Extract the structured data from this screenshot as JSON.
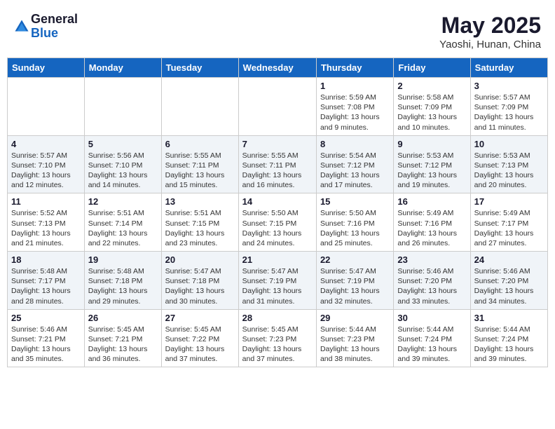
{
  "header": {
    "logo_general": "General",
    "logo_blue": "Blue",
    "month": "May 2025",
    "location": "Yaoshi, Hunan, China"
  },
  "weekdays": [
    "Sunday",
    "Monday",
    "Tuesday",
    "Wednesday",
    "Thursday",
    "Friday",
    "Saturday"
  ],
  "weeks": [
    [
      {
        "day": "",
        "sunrise": "",
        "sunset": "",
        "daylight": ""
      },
      {
        "day": "",
        "sunrise": "",
        "sunset": "",
        "daylight": ""
      },
      {
        "day": "",
        "sunrise": "",
        "sunset": "",
        "daylight": ""
      },
      {
        "day": "",
        "sunrise": "",
        "sunset": "",
        "daylight": ""
      },
      {
        "day": "1",
        "sunrise": "Sunrise: 5:59 AM",
        "sunset": "Sunset: 7:08 PM",
        "daylight": "Daylight: 13 hours and 9 minutes."
      },
      {
        "day": "2",
        "sunrise": "Sunrise: 5:58 AM",
        "sunset": "Sunset: 7:09 PM",
        "daylight": "Daylight: 13 hours and 10 minutes."
      },
      {
        "day": "3",
        "sunrise": "Sunrise: 5:57 AM",
        "sunset": "Sunset: 7:09 PM",
        "daylight": "Daylight: 13 hours and 11 minutes."
      }
    ],
    [
      {
        "day": "4",
        "sunrise": "Sunrise: 5:57 AM",
        "sunset": "Sunset: 7:10 PM",
        "daylight": "Daylight: 13 hours and 12 minutes."
      },
      {
        "day": "5",
        "sunrise": "Sunrise: 5:56 AM",
        "sunset": "Sunset: 7:10 PM",
        "daylight": "Daylight: 13 hours and 14 minutes."
      },
      {
        "day": "6",
        "sunrise": "Sunrise: 5:55 AM",
        "sunset": "Sunset: 7:11 PM",
        "daylight": "Daylight: 13 hours and 15 minutes."
      },
      {
        "day": "7",
        "sunrise": "Sunrise: 5:55 AM",
        "sunset": "Sunset: 7:11 PM",
        "daylight": "Daylight: 13 hours and 16 minutes."
      },
      {
        "day": "8",
        "sunrise": "Sunrise: 5:54 AM",
        "sunset": "Sunset: 7:12 PM",
        "daylight": "Daylight: 13 hours and 17 minutes."
      },
      {
        "day": "9",
        "sunrise": "Sunrise: 5:53 AM",
        "sunset": "Sunset: 7:12 PM",
        "daylight": "Daylight: 13 hours and 19 minutes."
      },
      {
        "day": "10",
        "sunrise": "Sunrise: 5:53 AM",
        "sunset": "Sunset: 7:13 PM",
        "daylight": "Daylight: 13 hours and 20 minutes."
      }
    ],
    [
      {
        "day": "11",
        "sunrise": "Sunrise: 5:52 AM",
        "sunset": "Sunset: 7:13 PM",
        "daylight": "Daylight: 13 hours and 21 minutes."
      },
      {
        "day": "12",
        "sunrise": "Sunrise: 5:51 AM",
        "sunset": "Sunset: 7:14 PM",
        "daylight": "Daylight: 13 hours and 22 minutes."
      },
      {
        "day": "13",
        "sunrise": "Sunrise: 5:51 AM",
        "sunset": "Sunset: 7:15 PM",
        "daylight": "Daylight: 13 hours and 23 minutes."
      },
      {
        "day": "14",
        "sunrise": "Sunrise: 5:50 AM",
        "sunset": "Sunset: 7:15 PM",
        "daylight": "Daylight: 13 hours and 24 minutes."
      },
      {
        "day": "15",
        "sunrise": "Sunrise: 5:50 AM",
        "sunset": "Sunset: 7:16 PM",
        "daylight": "Daylight: 13 hours and 25 minutes."
      },
      {
        "day": "16",
        "sunrise": "Sunrise: 5:49 AM",
        "sunset": "Sunset: 7:16 PM",
        "daylight": "Daylight: 13 hours and 26 minutes."
      },
      {
        "day": "17",
        "sunrise": "Sunrise: 5:49 AM",
        "sunset": "Sunset: 7:17 PM",
        "daylight": "Daylight: 13 hours and 27 minutes."
      }
    ],
    [
      {
        "day": "18",
        "sunrise": "Sunrise: 5:48 AM",
        "sunset": "Sunset: 7:17 PM",
        "daylight": "Daylight: 13 hours and 28 minutes."
      },
      {
        "day": "19",
        "sunrise": "Sunrise: 5:48 AM",
        "sunset": "Sunset: 7:18 PM",
        "daylight": "Daylight: 13 hours and 29 minutes."
      },
      {
        "day": "20",
        "sunrise": "Sunrise: 5:47 AM",
        "sunset": "Sunset: 7:18 PM",
        "daylight": "Daylight: 13 hours and 30 minutes."
      },
      {
        "day": "21",
        "sunrise": "Sunrise: 5:47 AM",
        "sunset": "Sunset: 7:19 PM",
        "daylight": "Daylight: 13 hours and 31 minutes."
      },
      {
        "day": "22",
        "sunrise": "Sunrise: 5:47 AM",
        "sunset": "Sunset: 7:19 PM",
        "daylight": "Daylight: 13 hours and 32 minutes."
      },
      {
        "day": "23",
        "sunrise": "Sunrise: 5:46 AM",
        "sunset": "Sunset: 7:20 PM",
        "daylight": "Daylight: 13 hours and 33 minutes."
      },
      {
        "day": "24",
        "sunrise": "Sunrise: 5:46 AM",
        "sunset": "Sunset: 7:20 PM",
        "daylight": "Daylight: 13 hours and 34 minutes."
      }
    ],
    [
      {
        "day": "25",
        "sunrise": "Sunrise: 5:46 AM",
        "sunset": "Sunset: 7:21 PM",
        "daylight": "Daylight: 13 hours and 35 minutes."
      },
      {
        "day": "26",
        "sunrise": "Sunrise: 5:45 AM",
        "sunset": "Sunset: 7:21 PM",
        "daylight": "Daylight: 13 hours and 36 minutes."
      },
      {
        "day": "27",
        "sunrise": "Sunrise: 5:45 AM",
        "sunset": "Sunset: 7:22 PM",
        "daylight": "Daylight: 13 hours and 37 minutes."
      },
      {
        "day": "28",
        "sunrise": "Sunrise: 5:45 AM",
        "sunset": "Sunset: 7:23 PM",
        "daylight": "Daylight: 13 hours and 37 minutes."
      },
      {
        "day": "29",
        "sunrise": "Sunrise: 5:44 AM",
        "sunset": "Sunset: 7:23 PM",
        "daylight": "Daylight: 13 hours and 38 minutes."
      },
      {
        "day": "30",
        "sunrise": "Sunrise: 5:44 AM",
        "sunset": "Sunset: 7:24 PM",
        "daylight": "Daylight: 13 hours and 39 minutes."
      },
      {
        "day": "31",
        "sunrise": "Sunrise: 5:44 AM",
        "sunset": "Sunset: 7:24 PM",
        "daylight": "Daylight: 13 hours and 39 minutes."
      }
    ]
  ]
}
